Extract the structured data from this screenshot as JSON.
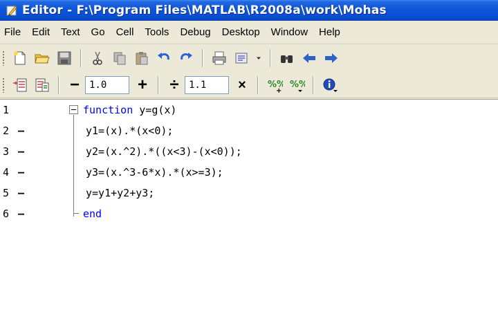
{
  "window": {
    "title": "Editor - F:\\Program Files\\MATLAB\\R2008a\\work\\Mohas"
  },
  "menu": [
    "File",
    "Edit",
    "Text",
    "Go",
    "Cell",
    "Tools",
    "Debug",
    "Desktop",
    "Window",
    "Help"
  ],
  "toolbar1": {
    "icons": [
      "new-file-icon",
      "open-folder-icon",
      "save-icon",
      "cut-icon",
      "copy-icon",
      "paste-icon",
      "undo-icon",
      "redo-icon",
      "print-icon",
      "comment-icon",
      "dropdown-icon",
      "find-icon",
      "back-icon",
      "forward-icon"
    ]
  },
  "toolbar2": {
    "decrement_label": "−",
    "increment_label": "+",
    "increment_value": "1.0",
    "divide_label": "÷",
    "multiply_label": "×",
    "scale_value": "1.1"
  },
  "editor": {
    "lines": [
      {
        "num": "1",
        "breakpoint": "",
        "keyword": "function",
        "rest": " y=g(x)"
      },
      {
        "num": "2",
        "breakpoint": "–",
        "keyword": "",
        "rest": "y1=(x).*(x<0);"
      },
      {
        "num": "3",
        "breakpoint": "–",
        "keyword": "",
        "rest": "y2=(x.^2).*((x<3)-(x<0));"
      },
      {
        "num": "4",
        "breakpoint": "–",
        "keyword": "",
        "rest": "y3=(x.^3-6*x).*(x>=3);"
      },
      {
        "num": "5",
        "breakpoint": "–",
        "keyword": "",
        "rest": "y=y1+y2+y3;"
      },
      {
        "num": "6",
        "breakpoint": "–",
        "keyword": "end",
        "rest": ""
      }
    ]
  },
  "colors": {
    "keyword": "#0000ff",
    "titlebar": "#0a4fd3"
  }
}
